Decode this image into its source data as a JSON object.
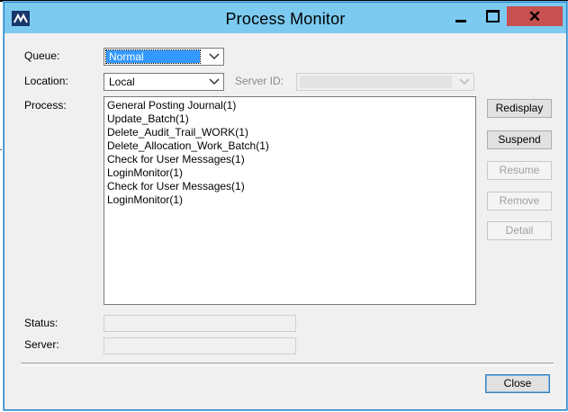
{
  "window": {
    "title": "Process Monitor"
  },
  "form": {
    "queue_label": "Queue:",
    "queue_value": "Normal",
    "location_label": "Location:",
    "location_value": "Local",
    "server_id_label": "Server ID:",
    "server_id_value": "",
    "process_label": "Process:",
    "status_label": "Status:",
    "status_value": "",
    "server_label": "Server:",
    "server_value": ""
  },
  "processes": [
    "General Posting Journal(1)",
    "Update_Batch(1)",
    "Delete_Audit_Trail_WORK(1)",
    "Delete_Allocation_Work_Batch(1)",
    "Check for User Messages(1)",
    "LoginMonitor(1)",
    "Check for User Messages(1)",
    "LoginMonitor(1)"
  ],
  "buttons": {
    "redisplay": "Redisplay",
    "suspend": "Suspend",
    "resume": "Resume",
    "remove": "Remove",
    "detail": "Detail",
    "close": "Close"
  },
  "icons": {
    "app": "microsoft-dynamics-logo-icon",
    "minimize": "minimize-icon",
    "maximize": "maximize-icon",
    "close": "close-icon",
    "dropdown": "chevron-down-icon"
  },
  "colors": {
    "titlebar": "#7ccaf0",
    "close_button": "#c75050",
    "selection": "#3399ff",
    "logo": "#17366a"
  }
}
